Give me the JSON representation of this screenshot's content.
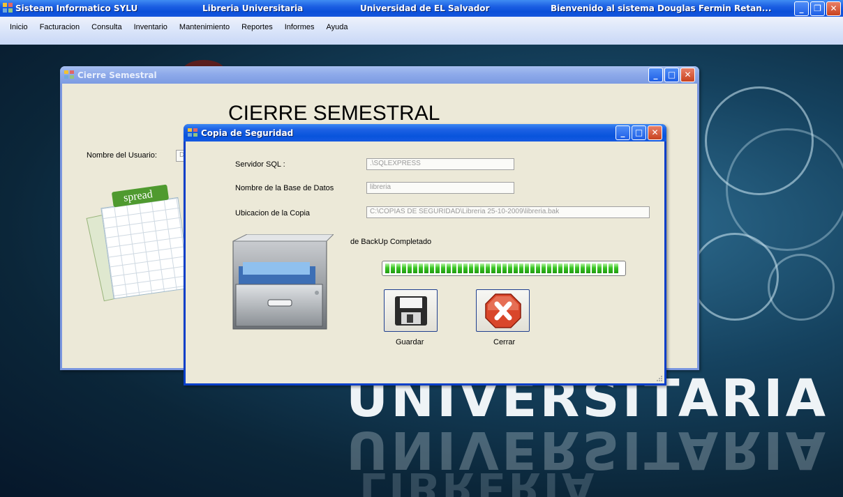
{
  "app_title": {
    "segments": [
      "Sisteam Informatico SYLU",
      "Libreria Universitaria",
      "Universidad de EL Salvador",
      "Bienvenido al sistema Douglas Fermin Retan..."
    ]
  },
  "menu": [
    "Inicio",
    "Facturacion",
    "Consulta",
    "Inventario",
    "Mantenimiento",
    "Reportes",
    "Informes",
    "Ayuda"
  ],
  "background": {
    "watermark": "UNIVERSITARIA",
    "reflection": "LIBRERIA"
  },
  "cierre_window": {
    "title": "Cierre Semestral",
    "heading": "CIERRE SEMESTRAL",
    "user_label": "Nombre del Usuario:",
    "user_value": "D",
    "spread_label": "spread"
  },
  "copia_window": {
    "title": "Copia de Seguridad",
    "server_label": "Servidor SQL :",
    "server_value": ".\\SQLEXPRESS",
    "db_label": "Nombre de la Base de Datos",
    "db_value": "libreria",
    "path_label": "Ubicacion de la Copia",
    "path_value": "C:\\COPIAS DE SEGURIDAD\\Libreria 25-10-2009\\libreria.bak",
    "status": "de BackUp Completado",
    "progress": 1.0,
    "save_label": "Guardar",
    "close_label": "Cerrar"
  },
  "colors": {
    "titlebar": "#0b4fd9",
    "progress_fill": "#2fbf1c",
    "close_button": "#d9462a"
  }
}
